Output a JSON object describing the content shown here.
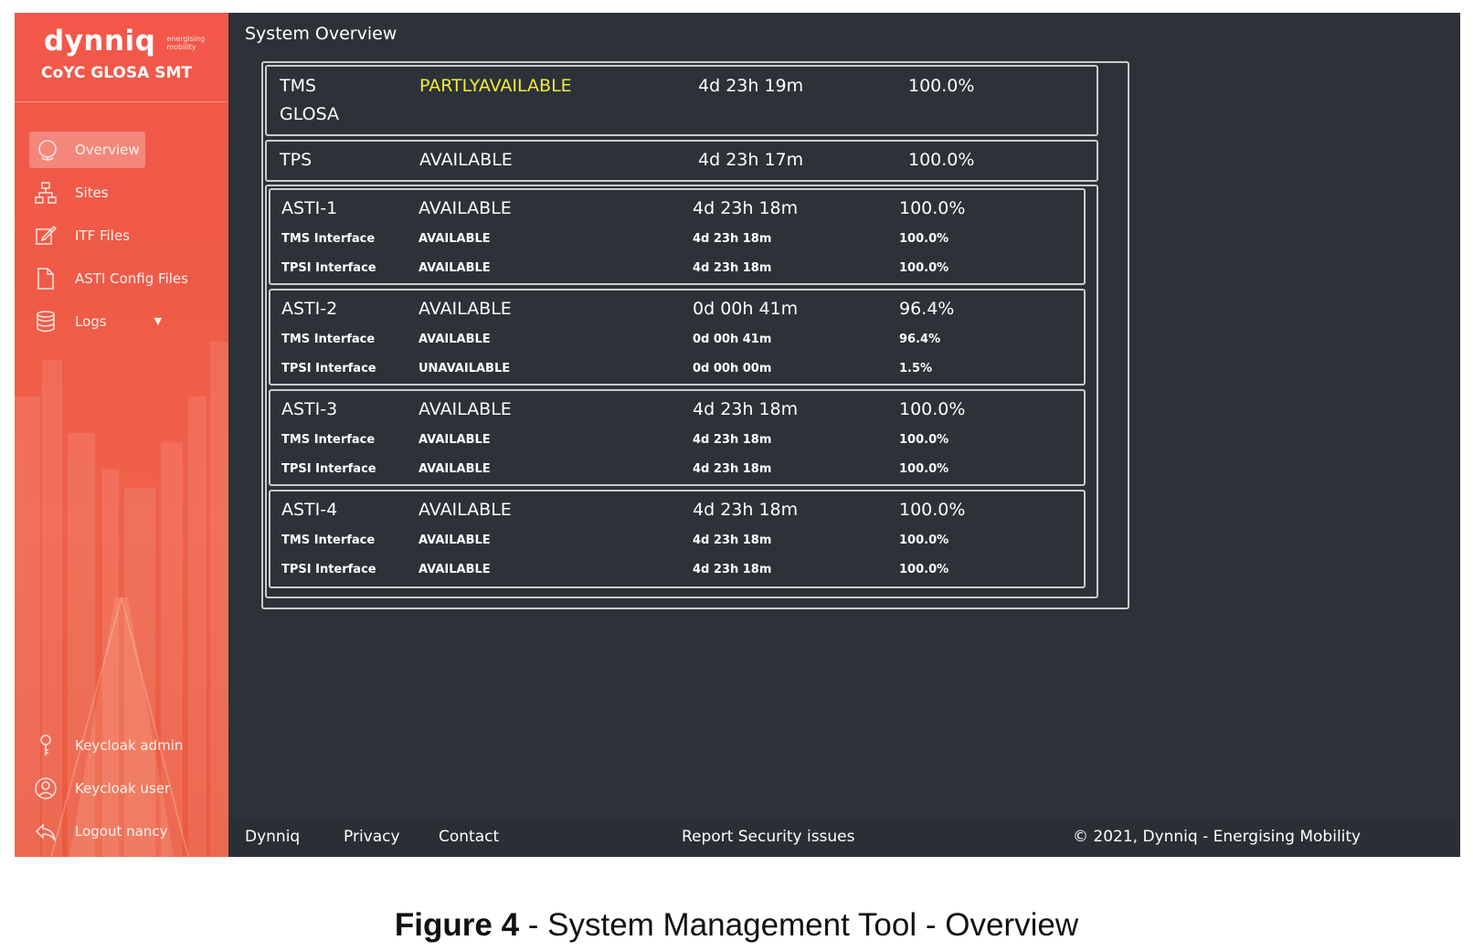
{
  "brand": {
    "logo": "dynniq",
    "tagline": "energising mobility",
    "product": "CoYC GLOSA SMT"
  },
  "nav": {
    "items": [
      {
        "label": "Overview",
        "icon": "globe-icon"
      },
      {
        "label": "Sites",
        "icon": "sitemap-icon"
      },
      {
        "label": "ITF Files",
        "icon": "edit-icon"
      },
      {
        "label": "ASTI Config Files",
        "icon": "file-icon"
      },
      {
        "label": "Logs",
        "icon": "database-icon"
      }
    ],
    "bottom": [
      {
        "label": "Keycloak admin",
        "icon": "key-icon"
      },
      {
        "label": "Keycloak user",
        "icon": "user-icon"
      },
      {
        "label": "Logout nancy",
        "icon": "reply-icon"
      }
    ]
  },
  "page_title": "System Overview",
  "systems": {
    "tms": {
      "name": "TMS",
      "name2": "GLOSA",
      "status": "PARTLYAVAILABLE",
      "uptime": "4d 23h 19m",
      "availability": "100.0%"
    },
    "tps": {
      "name": "TPS",
      "status": "AVAILABLE",
      "uptime": "4d 23h 17m",
      "availability": "100.0%"
    },
    "astis": [
      {
        "name": "ASTI-1",
        "status": "AVAILABLE",
        "uptime": "4d 23h 18m",
        "availability": "100.0%",
        "tms_label": "TMS Interface",
        "tms_status": "AVAILABLE",
        "tms_uptime": "4d 23h 18m",
        "tms_avail": "100.0%",
        "tpsi_label": "TPSI Interface",
        "tpsi_status": "AVAILABLE",
        "tpsi_uptime": "4d 23h 18m",
        "tpsi_avail": "100.0%"
      },
      {
        "name": "ASTI-2",
        "status": "AVAILABLE",
        "uptime": "0d 00h 41m",
        "availability": "96.4%",
        "tms_label": "TMS Interface",
        "tms_status": "AVAILABLE",
        "tms_uptime": "0d 00h 41m",
        "tms_avail": "96.4%",
        "tpsi_label": "TPSI Interface",
        "tpsi_status": "UNAVAILABLE",
        "tpsi_uptime": "0d 00h 00m",
        "tpsi_avail": "1.5%"
      },
      {
        "name": "ASTI-3",
        "status": "AVAILABLE",
        "uptime": "4d 23h 18m",
        "availability": "100.0%",
        "tms_label": "TMS Interface",
        "tms_status": "AVAILABLE",
        "tms_uptime": "4d 23h 18m",
        "tms_avail": "100.0%",
        "tpsi_label": "TPSI Interface",
        "tpsi_status": "AVAILABLE",
        "tpsi_uptime": "4d 23h 18m",
        "tpsi_avail": "100.0%"
      },
      {
        "name": "ASTI-4",
        "status": "AVAILABLE",
        "uptime": "4d 23h 18m",
        "availability": "100.0%",
        "tms_label": "TMS Interface",
        "tms_status": "AVAILABLE",
        "tms_uptime": "4d 23h 18m",
        "tms_avail": "100.0%",
        "tpsi_label": "TPSI Interface",
        "tpsi_status": "AVAILABLE",
        "tpsi_uptime": "4d 23h 18m",
        "tpsi_avail": "100.0%"
      }
    ]
  },
  "footer": {
    "dynniq": "Dynniq",
    "privacy": "Privacy",
    "contact": "Contact",
    "report": "Report Security issues",
    "copyright": "© 2021, Dynniq - Energising Mobility"
  },
  "caption": {
    "label": "Figure 4",
    "text": " - System Management Tool - Overview"
  },
  "colors": {
    "sidebar": "#f0574a",
    "main_bg": "#2c3238",
    "partly_available": "#f2ea3a"
  }
}
